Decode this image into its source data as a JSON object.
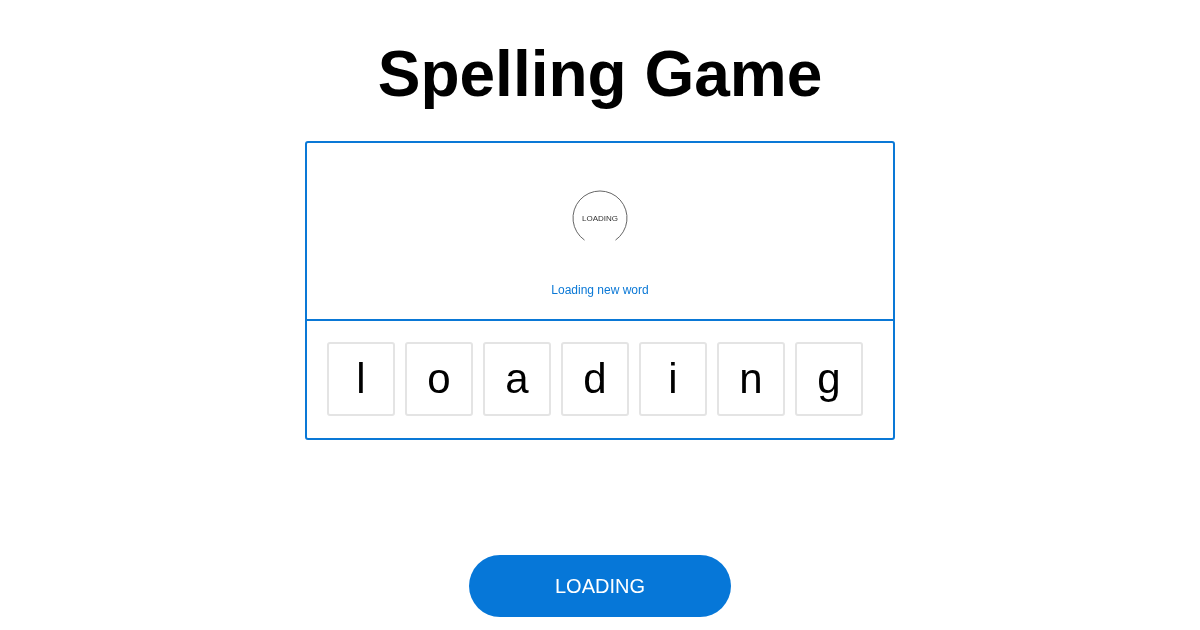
{
  "title": "Spelling Game",
  "word_panel": {
    "spinner_label": "LOADING",
    "status": "Loading new word"
  },
  "letter_tiles": [
    "l",
    "o",
    "a",
    "d",
    "i",
    "n",
    "g"
  ],
  "button": {
    "label": "LOADING"
  }
}
